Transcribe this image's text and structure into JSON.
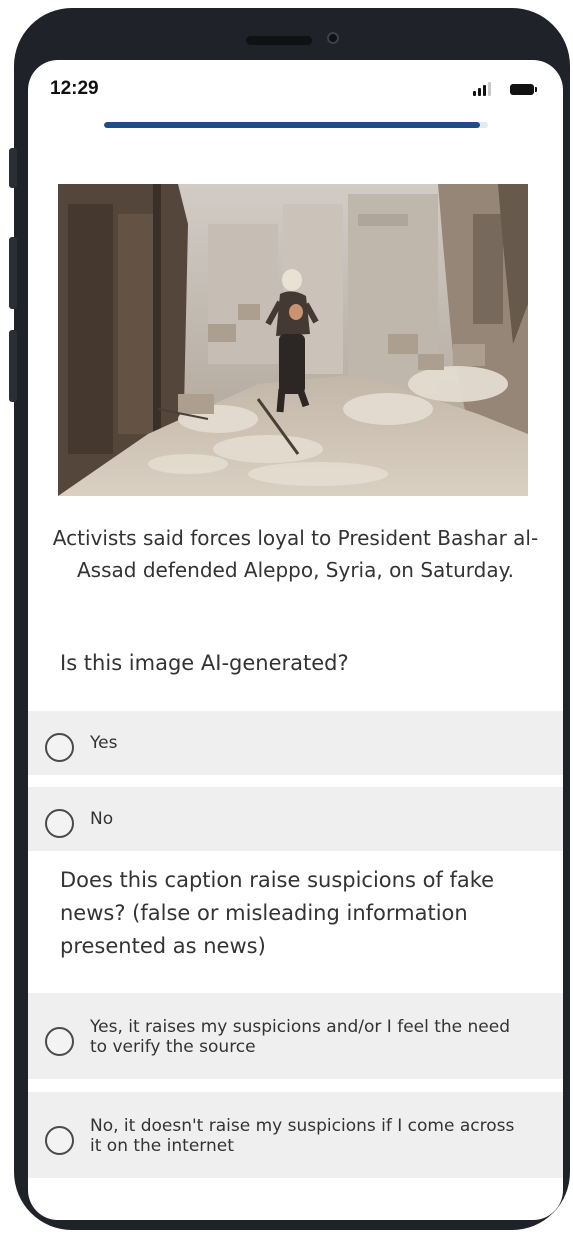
{
  "status_bar": {
    "time": "12:29"
  },
  "progress": {
    "fraction": 0.98,
    "color": "#1f4a8c"
  },
  "post": {
    "image_icon": "photo-icon",
    "caption": "Activists said forces loyal to President Bashar al-Assad defended Aleppo, Syria, on Saturday."
  },
  "question1": {
    "text": "Is this image AI-generated?",
    "options": [
      {
        "label": "Yes"
      },
      {
        "label": "No"
      }
    ]
  },
  "question2": {
    "text": "Does this caption raise suspicions of fake news? (false or misleading information presented as news)",
    "options": [
      {
        "label": "Yes, it raises my suspicions and/or I feel the need to verify the source"
      },
      {
        "label": "No, it doesn't raise my suspicions if I come across it on the internet"
      }
    ]
  },
  "colors": {
    "option_background": "#efefef",
    "text": "#333333",
    "frame": "#1f2329"
  }
}
